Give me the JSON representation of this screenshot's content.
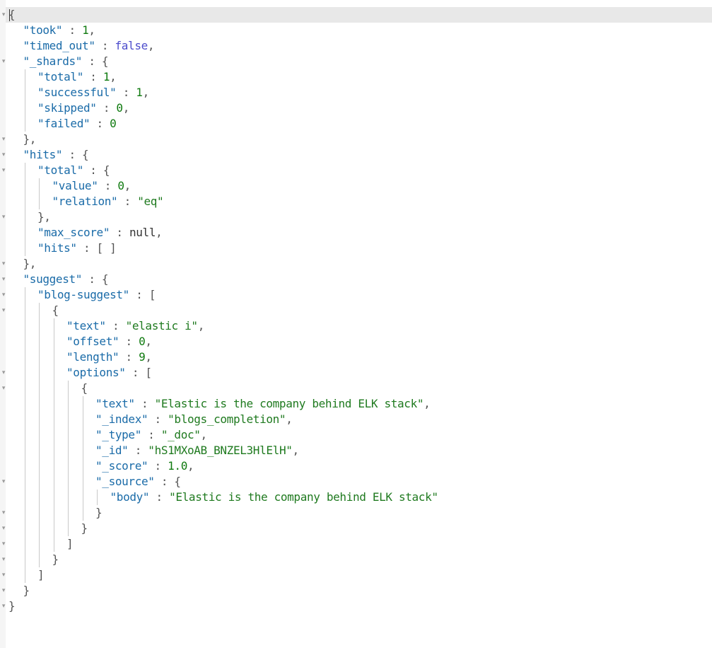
{
  "viewer": {
    "title": "",
    "colors": {
      "key": "#1a6ba8",
      "string": "#1f7a1f",
      "number": "#0f7a0f",
      "boolean": "#4d4dcc",
      "punctuation": "#555555",
      "active_line": "#e8e8e8",
      "gutter": "#f5f5f5",
      "indent_guide": "#c9c9c9"
    },
    "fold_marker": "▾",
    "lines": [
      {
        "indent": 0,
        "foldable": true,
        "active": true,
        "tokens": [
          {
            "t": "p",
            "v": "{"
          }
        ]
      },
      {
        "indent": 1,
        "tokens": [
          {
            "t": "k",
            "v": "\"took\""
          },
          {
            "t": "p",
            "v": " : "
          },
          {
            "t": "n",
            "v": "1"
          },
          {
            "t": "p",
            "v": ","
          }
        ]
      },
      {
        "indent": 1,
        "tokens": [
          {
            "t": "k",
            "v": "\"timed_out\""
          },
          {
            "t": "p",
            "v": " : "
          },
          {
            "t": "b",
            "v": "false"
          },
          {
            "t": "p",
            "v": ","
          }
        ]
      },
      {
        "indent": 1,
        "foldable": true,
        "tokens": [
          {
            "t": "k",
            "v": "\"_shards\""
          },
          {
            "t": "p",
            "v": " : {"
          }
        ]
      },
      {
        "indent": 2,
        "tokens": [
          {
            "t": "k",
            "v": "\"total\""
          },
          {
            "t": "p",
            "v": " : "
          },
          {
            "t": "n",
            "v": "1"
          },
          {
            "t": "p",
            "v": ","
          }
        ]
      },
      {
        "indent": 2,
        "tokens": [
          {
            "t": "k",
            "v": "\"successful\""
          },
          {
            "t": "p",
            "v": " : "
          },
          {
            "t": "n",
            "v": "1"
          },
          {
            "t": "p",
            "v": ","
          }
        ]
      },
      {
        "indent": 2,
        "tokens": [
          {
            "t": "k",
            "v": "\"skipped\""
          },
          {
            "t": "p",
            "v": " : "
          },
          {
            "t": "n",
            "v": "0"
          },
          {
            "t": "p",
            "v": ","
          }
        ]
      },
      {
        "indent": 2,
        "tokens": [
          {
            "t": "k",
            "v": "\"failed\""
          },
          {
            "t": "p",
            "v": " : "
          },
          {
            "t": "n",
            "v": "0"
          }
        ]
      },
      {
        "indent": 1,
        "foldable": true,
        "tokens": [
          {
            "t": "p",
            "v": "},"
          }
        ]
      },
      {
        "indent": 1,
        "foldable": true,
        "tokens": [
          {
            "t": "k",
            "v": "\"hits\""
          },
          {
            "t": "p",
            "v": " : {"
          }
        ]
      },
      {
        "indent": 2,
        "foldable": true,
        "tokens": [
          {
            "t": "k",
            "v": "\"total\""
          },
          {
            "t": "p",
            "v": " : {"
          }
        ]
      },
      {
        "indent": 3,
        "tokens": [
          {
            "t": "k",
            "v": "\"value\""
          },
          {
            "t": "p",
            "v": " : "
          },
          {
            "t": "n",
            "v": "0"
          },
          {
            "t": "p",
            "v": ","
          }
        ]
      },
      {
        "indent": 3,
        "tokens": [
          {
            "t": "k",
            "v": "\"relation\""
          },
          {
            "t": "p",
            "v": " : "
          },
          {
            "t": "s",
            "v": "\"eq\""
          }
        ]
      },
      {
        "indent": 2,
        "foldable": true,
        "tokens": [
          {
            "t": "p",
            "v": "},"
          }
        ]
      },
      {
        "indent": 2,
        "tokens": [
          {
            "t": "k",
            "v": "\"max_score\""
          },
          {
            "t": "p",
            "v": " : "
          },
          {
            "t": "nl",
            "v": "null"
          },
          {
            "t": "p",
            "v": ","
          }
        ]
      },
      {
        "indent": 2,
        "tokens": [
          {
            "t": "k",
            "v": "\"hits\""
          },
          {
            "t": "p",
            "v": " : [ ]"
          }
        ]
      },
      {
        "indent": 1,
        "foldable": true,
        "tokens": [
          {
            "t": "p",
            "v": "},"
          }
        ]
      },
      {
        "indent": 1,
        "foldable": true,
        "tokens": [
          {
            "t": "k",
            "v": "\"suggest\""
          },
          {
            "t": "p",
            "v": " : {"
          }
        ]
      },
      {
        "indent": 2,
        "foldable": true,
        "tokens": [
          {
            "t": "k",
            "v": "\"blog-suggest\""
          },
          {
            "t": "p",
            "v": " : ["
          }
        ]
      },
      {
        "indent": 3,
        "foldable": true,
        "tokens": [
          {
            "t": "p",
            "v": "{"
          }
        ]
      },
      {
        "indent": 4,
        "tokens": [
          {
            "t": "k",
            "v": "\"text\""
          },
          {
            "t": "p",
            "v": " : "
          },
          {
            "t": "s",
            "v": "\"elastic i\""
          },
          {
            "t": "p",
            "v": ","
          }
        ]
      },
      {
        "indent": 4,
        "tokens": [
          {
            "t": "k",
            "v": "\"offset\""
          },
          {
            "t": "p",
            "v": " : "
          },
          {
            "t": "n",
            "v": "0"
          },
          {
            "t": "p",
            "v": ","
          }
        ]
      },
      {
        "indent": 4,
        "tokens": [
          {
            "t": "k",
            "v": "\"length\""
          },
          {
            "t": "p",
            "v": " : "
          },
          {
            "t": "n",
            "v": "9"
          },
          {
            "t": "p",
            "v": ","
          }
        ]
      },
      {
        "indent": 4,
        "foldable": true,
        "tokens": [
          {
            "t": "k",
            "v": "\"options\""
          },
          {
            "t": "p",
            "v": " : ["
          }
        ]
      },
      {
        "indent": 5,
        "foldable": true,
        "tokens": [
          {
            "t": "p",
            "v": "{"
          }
        ]
      },
      {
        "indent": 6,
        "tokens": [
          {
            "t": "k",
            "v": "\"text\""
          },
          {
            "t": "p",
            "v": " : "
          },
          {
            "t": "s",
            "v": "\"Elastic is the company behind ELK stack\""
          },
          {
            "t": "p",
            "v": ","
          }
        ]
      },
      {
        "indent": 6,
        "tokens": [
          {
            "t": "k",
            "v": "\"_index\""
          },
          {
            "t": "p",
            "v": " : "
          },
          {
            "t": "s",
            "v": "\"blogs_completion\""
          },
          {
            "t": "p",
            "v": ","
          }
        ]
      },
      {
        "indent": 6,
        "tokens": [
          {
            "t": "k",
            "v": "\"_type\""
          },
          {
            "t": "p",
            "v": " : "
          },
          {
            "t": "s",
            "v": "\"_doc\""
          },
          {
            "t": "p",
            "v": ","
          }
        ]
      },
      {
        "indent": 6,
        "tokens": [
          {
            "t": "k",
            "v": "\"_id\""
          },
          {
            "t": "p",
            "v": " : "
          },
          {
            "t": "s",
            "v": "\"hS1MXoAB_BNZEL3HlElH\""
          },
          {
            "t": "p",
            "v": ","
          }
        ]
      },
      {
        "indent": 6,
        "tokens": [
          {
            "t": "k",
            "v": "\"_score\""
          },
          {
            "t": "p",
            "v": " : "
          },
          {
            "t": "n",
            "v": "1.0"
          },
          {
            "t": "p",
            "v": ","
          }
        ]
      },
      {
        "indent": 6,
        "foldable": true,
        "tokens": [
          {
            "t": "k",
            "v": "\"_source\""
          },
          {
            "t": "p",
            "v": " : {"
          }
        ]
      },
      {
        "indent": 7,
        "tokens": [
          {
            "t": "k",
            "v": "\"body\""
          },
          {
            "t": "p",
            "v": " : "
          },
          {
            "t": "s",
            "v": "\"Elastic is the company behind ELK stack\""
          }
        ]
      },
      {
        "indent": 6,
        "foldable": true,
        "tokens": [
          {
            "t": "p",
            "v": "}"
          }
        ]
      },
      {
        "indent": 5,
        "foldable": true,
        "tokens": [
          {
            "t": "p",
            "v": "}"
          }
        ]
      },
      {
        "indent": 4,
        "foldable": true,
        "tokens": [
          {
            "t": "p",
            "v": "]"
          }
        ]
      },
      {
        "indent": 3,
        "foldable": true,
        "tokens": [
          {
            "t": "p",
            "v": "}"
          }
        ]
      },
      {
        "indent": 2,
        "foldable": true,
        "tokens": [
          {
            "t": "p",
            "v": "]"
          }
        ]
      },
      {
        "indent": 1,
        "foldable": true,
        "tokens": [
          {
            "t": "p",
            "v": "}"
          }
        ]
      },
      {
        "indent": 0,
        "foldable": true,
        "tokens": [
          {
            "t": "p",
            "v": "}"
          }
        ]
      }
    ]
  }
}
